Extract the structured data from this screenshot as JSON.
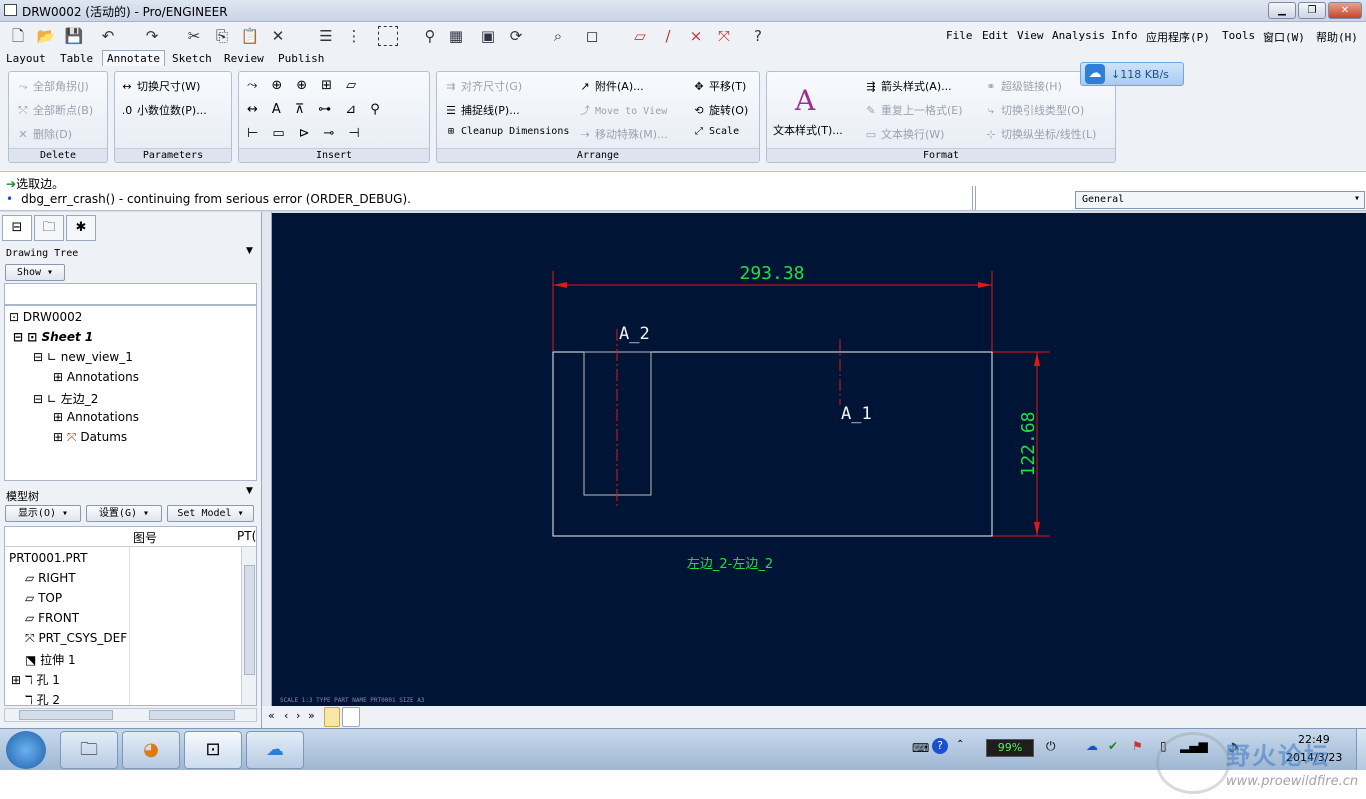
{
  "window": {
    "title": "DRW0002 (活动的) - Pro/ENGINEER"
  },
  "menu": [
    "File",
    "Edit",
    "View",
    "Analysis",
    "Info",
    "应用程序(P)",
    "Tools",
    "窗口(W)",
    "帮助(H)"
  ],
  "tabs": [
    "Layout",
    "Table",
    "Annotate",
    "Sketch",
    "Review",
    "Publish"
  ],
  "active_tab": "Annotate",
  "ribbon": {
    "delete": {
      "title": "Delete",
      "items": [
        "全部角拐(J)",
        "全部断点(B)",
        "删除(D)"
      ]
    },
    "parameters": {
      "title": "Parameters",
      "items": [
        "切换尺寸(W)",
        "小数位数(P)..."
      ]
    },
    "insert": {
      "title": "Insert"
    },
    "arrange": {
      "title": "Arrange",
      "items": [
        "对齐尺寸(G)",
        "捕捉线(P)...",
        "Cleanup Dimensions",
        "附件(A)...",
        "Move to View",
        "移动特殊(M)...",
        "平移(T)",
        "旋转(O)",
        "Scale"
      ]
    },
    "format": {
      "title": "Format",
      "big": "文本样式(T)...",
      "items": [
        "箭头样式(A)...",
        "重复上一格式(E)",
        "文本换行(W)",
        "超级链接(H)",
        "切换引线类型(O)",
        "切换纵坐标/线性(L)"
      ]
    },
    "speed": "↓118 KB/s"
  },
  "messages": [
    "选取边。",
    "dbg_err_crash() - continuing from serious error (ORDER_DEBUG)."
  ],
  "filter": "General",
  "drawing_tree": {
    "title": "Drawing Tree",
    "show": "Show",
    "nodes": [
      "DRW0002",
      "Sheet 1",
      "new_view_1",
      "Annotations",
      "左边_2",
      "Annotations",
      "Datums"
    ]
  },
  "model_tree": {
    "title": "模型树",
    "buttons": [
      "显示(O)",
      "设置(G)",
      "Set Model"
    ],
    "col_header": "图号",
    "col2": "PT(",
    "root": "PRT0001.PRT",
    "items": [
      "RIGHT",
      "TOP",
      "FRONT",
      "PRT_CSYS_DEF",
      "拉伸 1",
      "孔 1",
      "孔 2"
    ]
  },
  "drawing": {
    "dim_h": "293.38",
    "dim_v": "122.68",
    "label_a2": "A_2",
    "label_a1": "A_1",
    "view_label": "左边_2-左边_2",
    "footer_text": "SCALE 1:3   TYPE PART   NAME PRT0001   SIZE A3",
    "colors": {
      "bg": "#001436",
      "dim": "#e01818",
      "text": "#22dd44",
      "lines": "#f4f4f4"
    }
  },
  "taskbar": {
    "battery": "99%",
    "time": "22:49",
    "date": "2014/3/23"
  },
  "watermark": {
    "text": "野火论坛",
    "url": "www.proewildfire.cn"
  }
}
